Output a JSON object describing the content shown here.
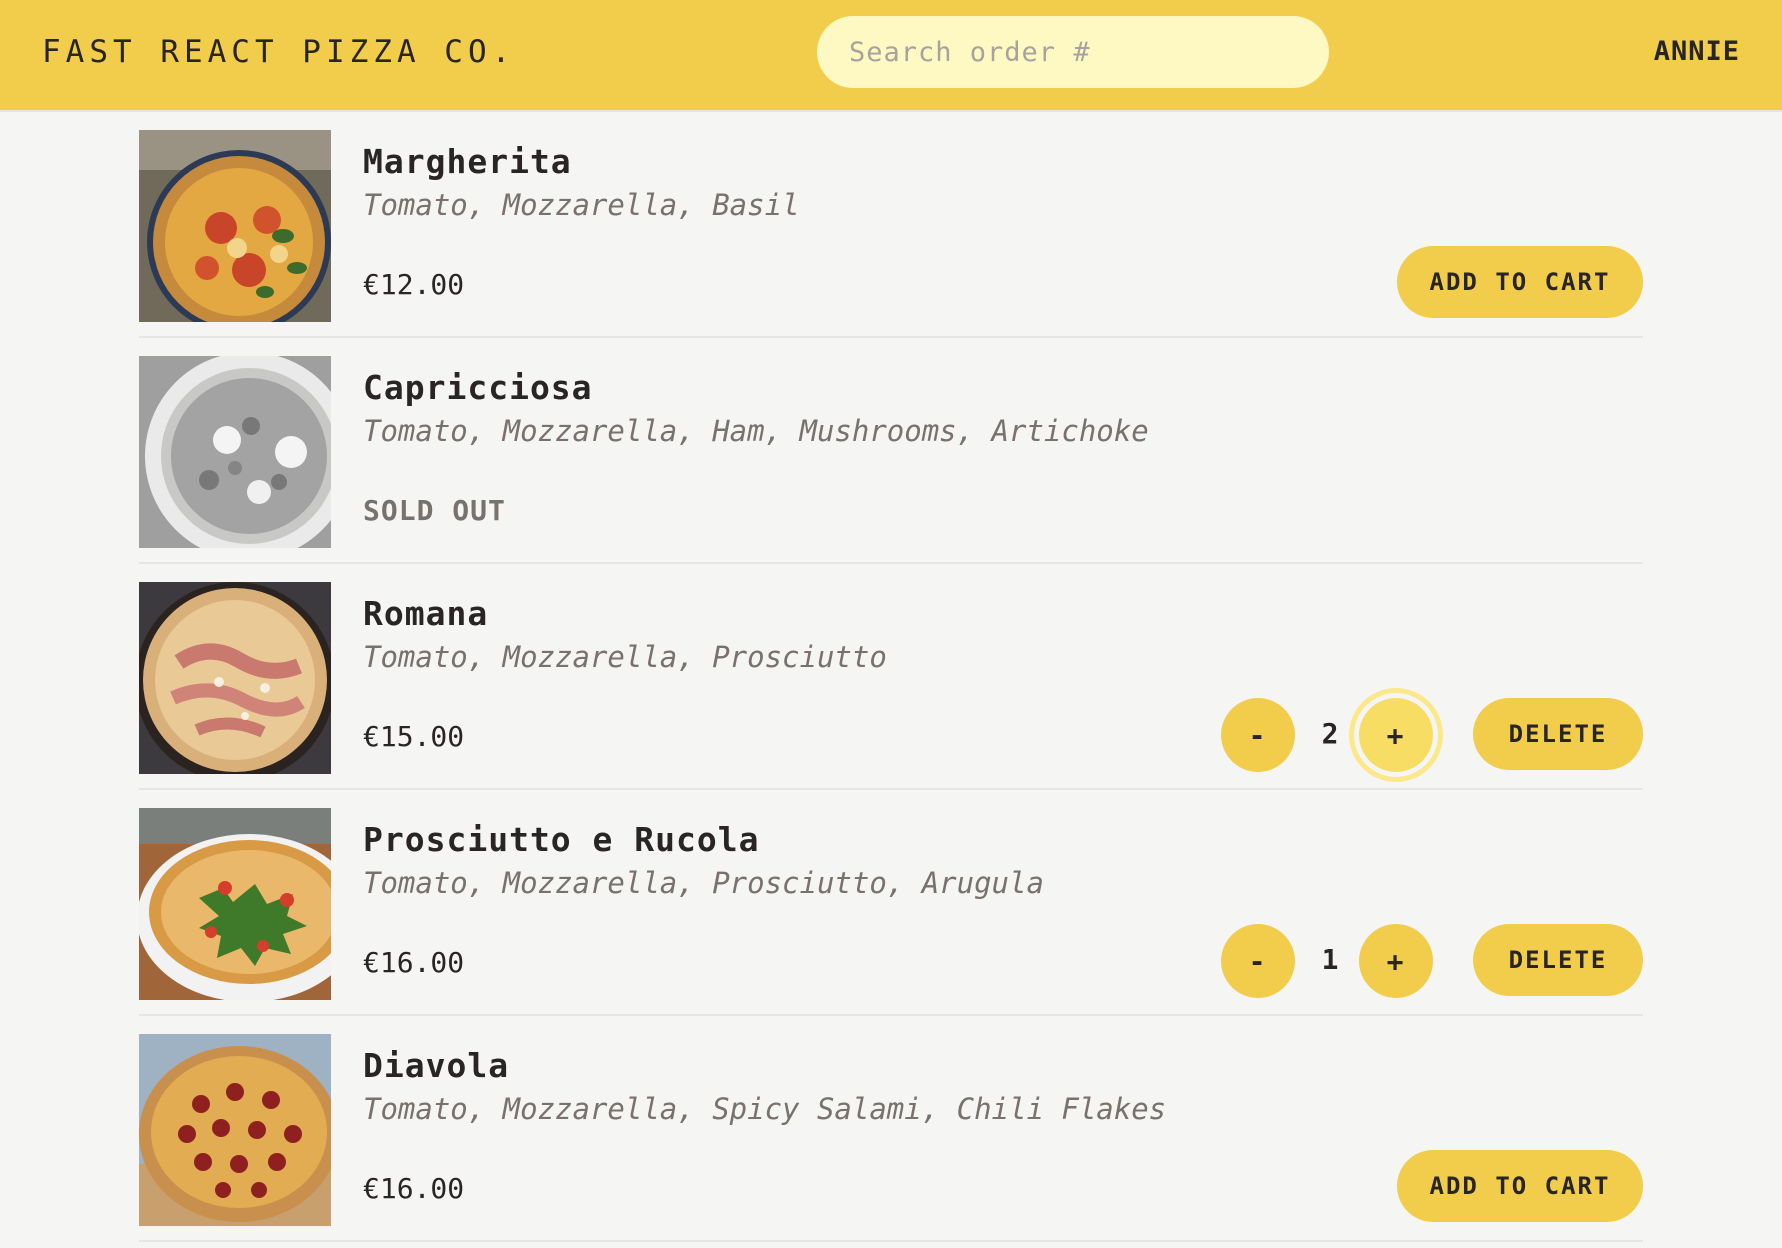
{
  "header": {
    "logo": "Fast React Pizza Co.",
    "search_placeholder": "Search order #",
    "username": "ANNIE"
  },
  "colors": {
    "brand_yellow": "#f2cd4b",
    "search_bg": "#fef9c3",
    "page_bg": "#f5f5f4",
    "text": "#292524",
    "muted": "#78716c"
  },
  "menu": {
    "items": [
      {
        "name": "Margherita",
        "ingredients": "Tomato, Mozzarella, Basil",
        "price": "€12.00",
        "add_label": "Add to cart",
        "image_icon": "margherita-pizza-photo"
      },
      {
        "name": "Capricciosa",
        "ingredients": "Tomato, Mozzarella, Ham, Mushrooms, Artichoke",
        "status": "Sold out",
        "image_icon": "capricciosa-pizza-photo"
      },
      {
        "name": "Romana",
        "ingredients": "Tomato, Mozzarella, Prosciutto",
        "price": "€15.00",
        "quantity": "2",
        "minus_label": "-",
        "plus_label": "+",
        "delete_label": "Delete",
        "image_icon": "romana-pizza-photo"
      },
      {
        "name": "Prosciutto e Rucola",
        "ingredients": "Tomato, Mozzarella, Prosciutto, Arugula",
        "price": "€16.00",
        "quantity": "1",
        "minus_label": "-",
        "plus_label": "+",
        "delete_label": "Delete",
        "image_icon": "prosciutto-rucola-pizza-photo"
      },
      {
        "name": "Diavola",
        "ingredients": "Tomato, Mozzarella, Spicy Salami, Chili Flakes",
        "price": "€16.00",
        "add_label": "Add to cart",
        "image_icon": "diavola-pizza-photo"
      }
    ]
  }
}
